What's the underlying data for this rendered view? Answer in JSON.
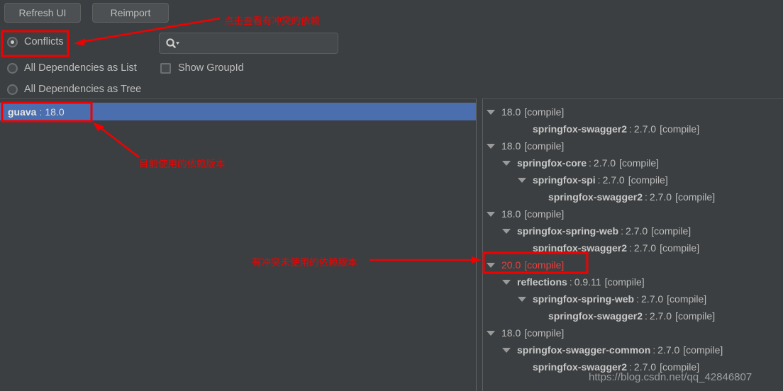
{
  "toolbar": {
    "refresh_label": "Refresh UI",
    "reimport_label": "Reimport",
    "search_placeholder": "",
    "search_value": "",
    "search_icon": "search-icon",
    "dropdown_icon": "chevron-down-icon",
    "show_groupid_label": "Show GroupId",
    "show_groupid_checked": false,
    "radios": [
      {
        "label": "Conflicts",
        "selected": true
      },
      {
        "label": "All Dependencies as List",
        "selected": false
      },
      {
        "label": "All Dependencies as Tree",
        "selected": false
      }
    ]
  },
  "left_panel": {
    "selected_item": {
      "name": "guava",
      "separator": ":",
      "version": "18.0"
    }
  },
  "right_panel": {
    "rows": [
      {
        "indent": 0,
        "twisty": true,
        "name": "",
        "version": "18.0",
        "scope": "[compile]",
        "conflict": false
      },
      {
        "indent": 2,
        "twisty": false,
        "name": "springfox-swagger2",
        "version": "2.7.0",
        "scope": "[compile]",
        "conflict": false
      },
      {
        "indent": 0,
        "twisty": true,
        "name": "",
        "version": "18.0",
        "scope": "[compile]",
        "conflict": false
      },
      {
        "indent": 1,
        "twisty": true,
        "name": "springfox-core",
        "version": "2.7.0",
        "scope": "[compile]",
        "conflict": false
      },
      {
        "indent": 2,
        "twisty": true,
        "name": "springfox-spi",
        "version": "2.7.0",
        "scope": "[compile]",
        "conflict": false
      },
      {
        "indent": 3,
        "twisty": false,
        "name": "springfox-swagger2",
        "version": "2.7.0",
        "scope": "[compile]",
        "conflict": false
      },
      {
        "indent": 0,
        "twisty": true,
        "name": "",
        "version": "18.0",
        "scope": "[compile]",
        "conflict": false
      },
      {
        "indent": 1,
        "twisty": true,
        "name": "springfox-spring-web",
        "version": "2.7.0",
        "scope": "[compile]",
        "conflict": false
      },
      {
        "indent": 2,
        "twisty": false,
        "name": "springfox-swagger2",
        "version": "2.7.0",
        "scope": "[compile]",
        "conflict": false
      },
      {
        "indent": 0,
        "twisty": true,
        "name": "",
        "version": "20.0",
        "scope": "[compile]",
        "conflict": true
      },
      {
        "indent": 1,
        "twisty": true,
        "name": "reflections",
        "version": "0.9.11",
        "scope": "[compile]",
        "conflict": false
      },
      {
        "indent": 2,
        "twisty": true,
        "name": "springfox-spring-web",
        "version": "2.7.0",
        "scope": "[compile]",
        "conflict": false
      },
      {
        "indent": 3,
        "twisty": false,
        "name": "springfox-swagger2",
        "version": "2.7.0",
        "scope": "[compile]",
        "conflict": false
      },
      {
        "indent": 0,
        "twisty": true,
        "name": "",
        "version": "18.0",
        "scope": "[compile]",
        "conflict": false
      },
      {
        "indent": 1,
        "twisty": true,
        "name": "springfox-swagger-common",
        "version": "2.7.0",
        "scope": "[compile]",
        "conflict": false
      },
      {
        "indent": 2,
        "twisty": false,
        "name": "springfox-swagger2",
        "version": "2.7.0",
        "scope": "[compile]",
        "conflict": false
      }
    ]
  },
  "annotations": {
    "text_conflicts": "点击查看有冲突的依赖",
    "text_current_version": "目前使用的依赖版本",
    "text_conflict_unused": "有冲突未使用的依赖版本",
    "color": "#f20000"
  },
  "watermark": "https://blog.csdn.net/qq_42846807"
}
